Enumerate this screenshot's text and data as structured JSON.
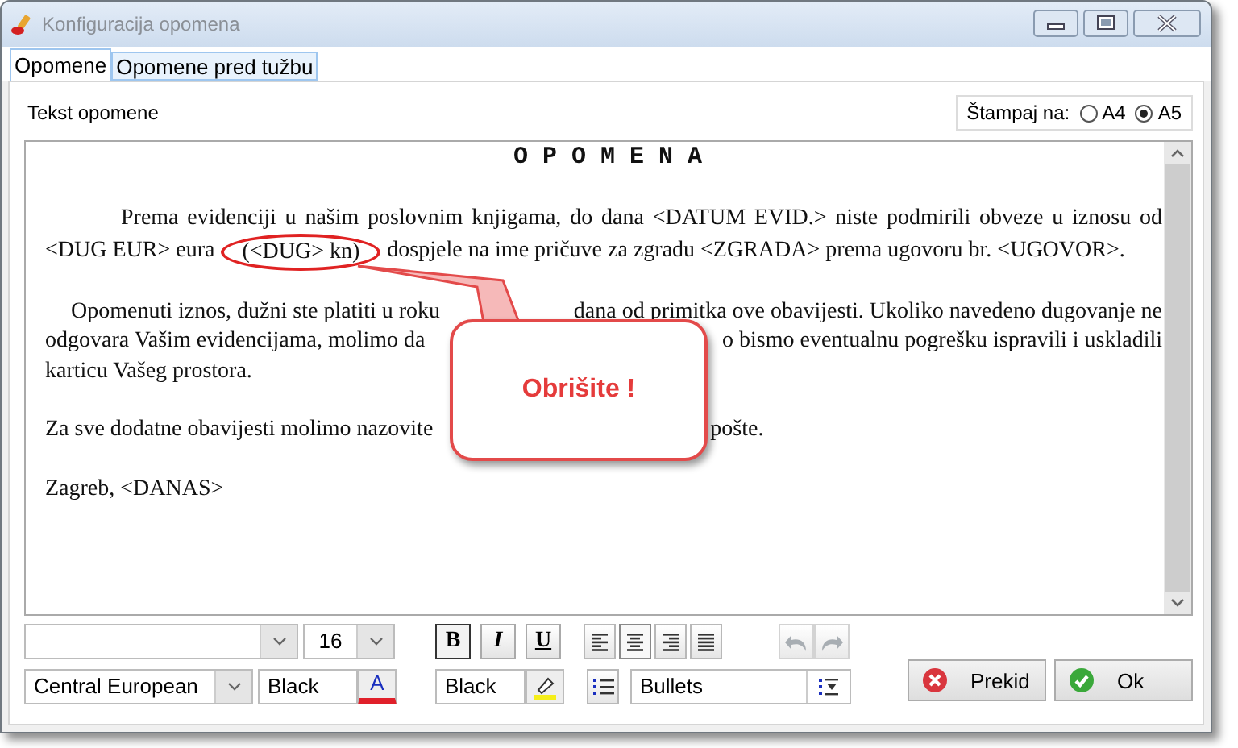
{
  "window": {
    "title": "Konfiguracija opomena"
  },
  "tabs": [
    {
      "label": "Opomene",
      "selected": true
    },
    {
      "label": "Opomene pred tužbu",
      "selected": false
    }
  ],
  "section_label": "Tekst opomene",
  "print_on": {
    "label": "Štampaj na:",
    "options": [
      {
        "label": "A4",
        "selected": false
      },
      {
        "label": "A5",
        "selected": true
      }
    ]
  },
  "document": {
    "title": "O P O M E N A",
    "paragraphs": [
      {
        "kind": "indented",
        "lines": [
          {
            "segments": [
              {
                "text": "Prema evidenciji u našim poslovnim knjigama, do dana <DATUM EVID.> niste podmirili obveze u iznosu od",
                "circled": false
              }
            ]
          },
          {
            "segments": [
              {
                "text": "<DUG EUR> eura",
                "circled": false
              },
              {
                "text": "(<DUG> kn)",
                "circled": true
              },
              {
                "text": "dospjele na ime pričuve za zgradu <ZGRADA> prema ugovoru br. <UGOVOR>.",
                "circled": false
              }
            ]
          }
        ]
      },
      {
        "kind": "spaced",
        "lines": [
          {
            "segments": [
              {
                "text": "Opomenuti iznos, dužni ste platiti u roku",
                "circled": false
              },
              {
                "text": "dana od primitka ove obavijesti. Ukoliko navedeno dugovanje ne",
                "circled": false
              }
            ]
          },
          {
            "segments": [
              {
                "text": "odgovara Vašim evidencijama, molimo da",
                "circled": false
              },
              {
                "text": "o bismo eventualnu pogrešku ispravili i uskladili",
                "circled": false
              }
            ]
          },
          {
            "segments": [
              {
                "text": "karticu Vašeg prostora.",
                "circled": false
              }
            ]
          }
        ]
      },
      {
        "kind": "plain",
        "lines": [
          {
            "segments": [
              {
                "text": "Za sve dodatne obavijesti molimo nazovite",
                "circled": false
              },
              {
                "text": "pošte.",
                "circled": false
              }
            ]
          }
        ]
      },
      {
        "kind": "plain",
        "lines": [
          {
            "segments": [
              {
                "text": "Zagreb, <DANAS>",
                "circled": false
              }
            ]
          }
        ]
      }
    ]
  },
  "callout": {
    "text": "Obrišite !"
  },
  "toolbar": {
    "size": "16",
    "format_buttons": [
      {
        "kind": "bold",
        "label": "B",
        "pressed": true
      },
      {
        "kind": "italic",
        "label": "I",
        "pressed": false
      },
      {
        "kind": "underline",
        "label": "U",
        "pressed": false
      }
    ],
    "align_buttons": [
      {
        "kind": "left",
        "pressed": false
      },
      {
        "kind": "center",
        "pressed": true
      },
      {
        "kind": "right",
        "pressed": false
      },
      {
        "kind": "justify",
        "pressed": false
      }
    ],
    "history_buttons": [
      {
        "kind": "undo",
        "disabled": true
      },
      {
        "kind": "redo",
        "disabled": true
      }
    ],
    "charset": "Central European",
    "font_color": {
      "value": "Black",
      "glyph": "A"
    },
    "highlight_color": {
      "value": "Black"
    },
    "list_style": "Bullets"
  },
  "buttons": [
    {
      "kind": "cancel",
      "label": "Prekid"
    },
    {
      "kind": "ok",
      "label": "Ok"
    }
  ]
}
